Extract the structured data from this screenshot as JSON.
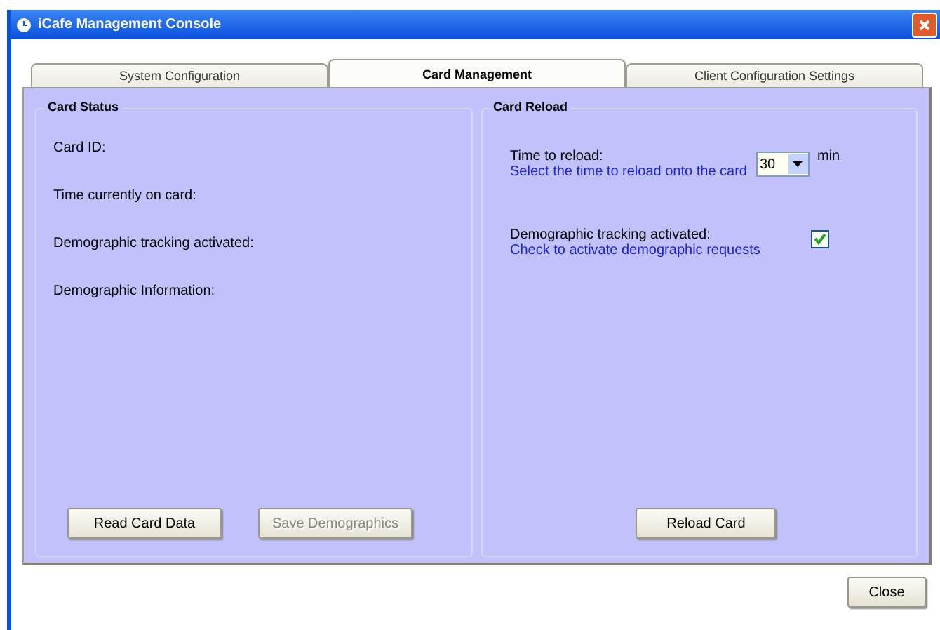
{
  "window": {
    "title": "iCafe Management Console"
  },
  "tabs": [
    {
      "label": "System Configuration",
      "selected": false
    },
    {
      "label": "Card Management",
      "selected": true
    },
    {
      "label": "Client Configuration Settings",
      "selected": false
    }
  ],
  "card_status": {
    "title": "Card Status",
    "fields": [
      "Card ID:",
      "Time currently on card:",
      "Demographic tracking activated:",
      "Demographic Information:"
    ],
    "buttons": [
      {
        "label": "Read Card Data",
        "disabled": false
      },
      {
        "label": "Save Demographics",
        "disabled": true
      }
    ]
  },
  "card_reload": {
    "title": "Card Reload",
    "time_label": "Time to reload:",
    "time_hint": "Select the time to reload onto the card",
    "time_value": "30",
    "time_unit": "min",
    "tracking_label": "Demographic tracking activated:",
    "tracking_hint": "Check to activate demographic requests",
    "tracking_checked": true,
    "button": "Reload Card"
  },
  "close_button": "Close"
}
